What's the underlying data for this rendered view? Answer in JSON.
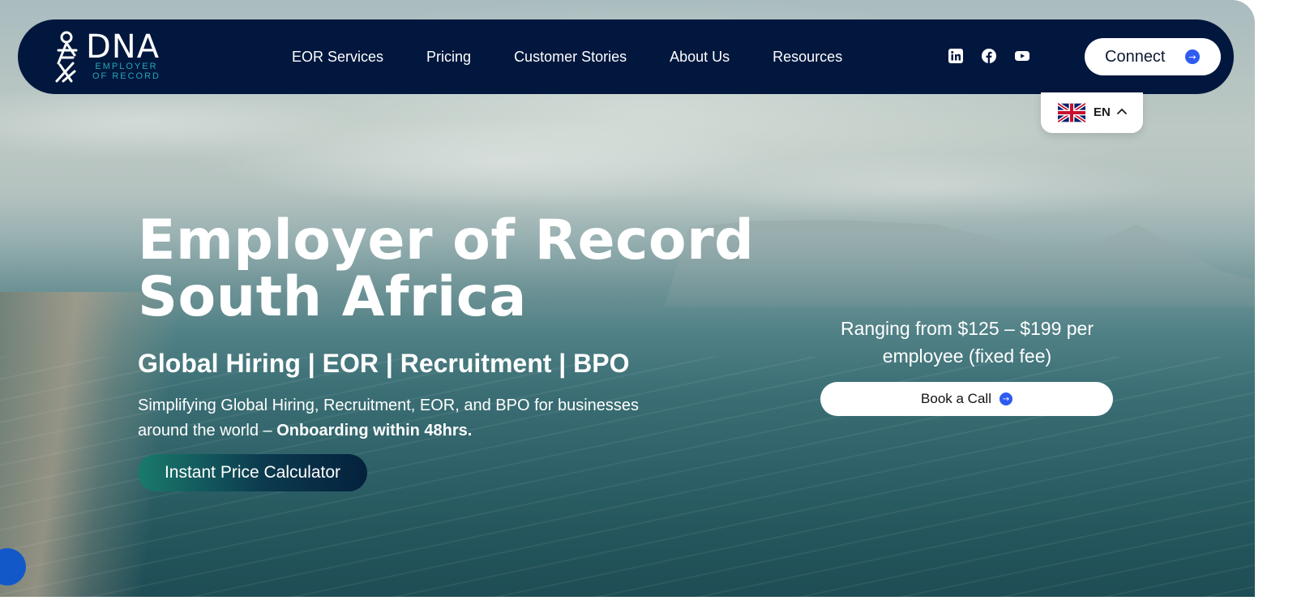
{
  "brand": {
    "name": "DNA",
    "tagline": "EMPLOYER OF RECORD"
  },
  "nav": {
    "items": [
      {
        "label": "EOR Services"
      },
      {
        "label": "Pricing"
      },
      {
        "label": "Customer Stories"
      },
      {
        "label": "About Us"
      },
      {
        "label": "Resources"
      }
    ],
    "social_icons": [
      "linkedin-icon",
      "facebook-icon",
      "youtube-icon"
    ],
    "connect_label": "Connect"
  },
  "language": {
    "code": "EN",
    "flag": "uk-flag-icon"
  },
  "hero": {
    "title_line1": "Employer of Record",
    "title_line2": "South Africa",
    "subtitle": "Global Hiring | EOR | Recruitment | BPO",
    "description": "Simplifying Global Hiring, Recruitment, EOR, and BPO for businesses around the world – ",
    "description_bold": "Onboarding within 48hrs.",
    "calculator_button": "Instant Price Calculator"
  },
  "pricing": {
    "line1": "Ranging from $125 – $199 per",
    "line2": "employee (fixed fee)",
    "book_button": "Book a Call"
  },
  "colors": {
    "nav_bg": "#01173e",
    "accent_blue": "#2f5bf0",
    "brand_teal": "#27a6b5",
    "chat_blue": "#1258c9"
  }
}
